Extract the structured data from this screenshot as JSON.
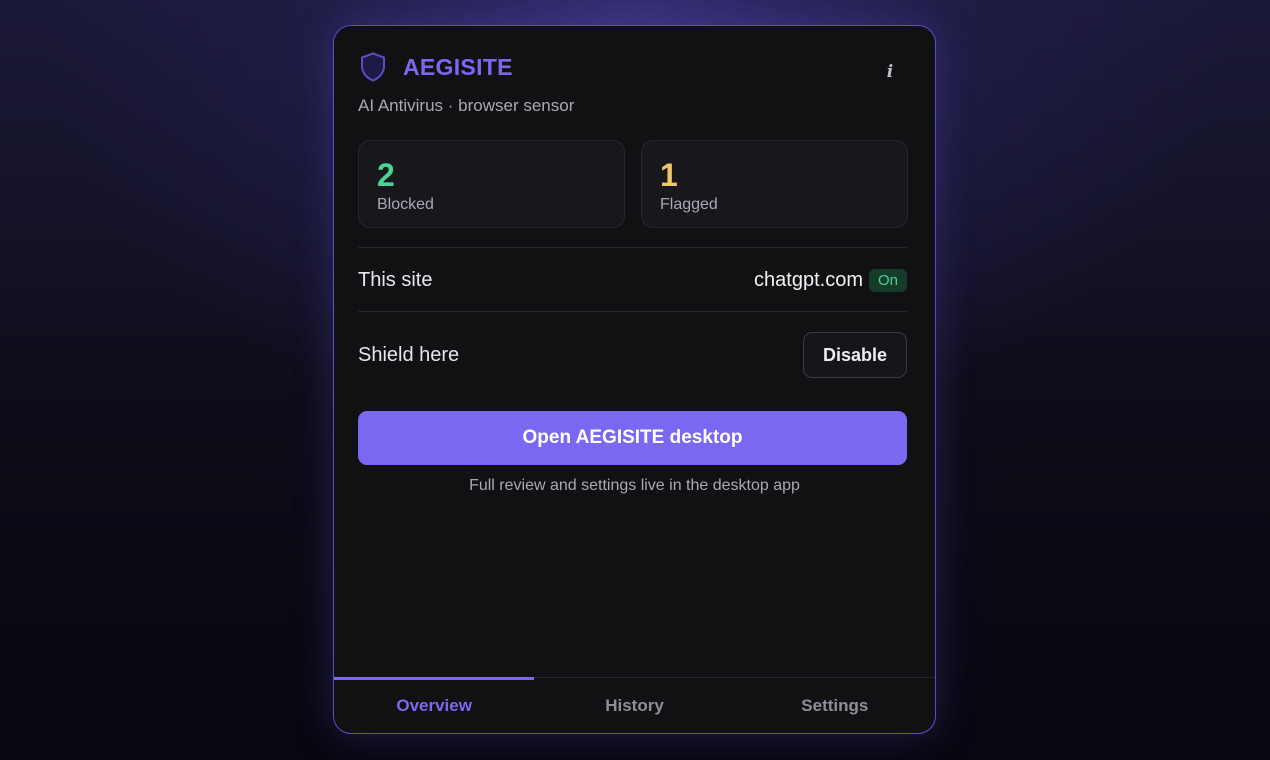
{
  "app": {
    "name": "AEGISITE",
    "subtitle": "AI Antivirus · browser sensor",
    "info_label": "i"
  },
  "stats": [
    {
      "value": "2",
      "label": "Blocked",
      "color": "#4ad493"
    },
    {
      "value": "1",
      "label": "Flagged",
      "color": "#f2c46a"
    }
  ],
  "site": {
    "label": "This site",
    "domain": "chatgpt.com",
    "status": "On"
  },
  "shield": {
    "label": "Shield here",
    "button_label": "Disable"
  },
  "cta": {
    "label": "Open AEGISITE desktop",
    "note": "Full review and settings live in the desktop app"
  },
  "tabs": [
    {
      "label": "Overview",
      "active": true
    },
    {
      "label": "History",
      "active": false
    },
    {
      "label": "Settings",
      "active": false
    }
  ],
  "colors": {
    "accent": "#7b68f0",
    "positive": "#4ad493",
    "warning": "#f2c46a"
  }
}
